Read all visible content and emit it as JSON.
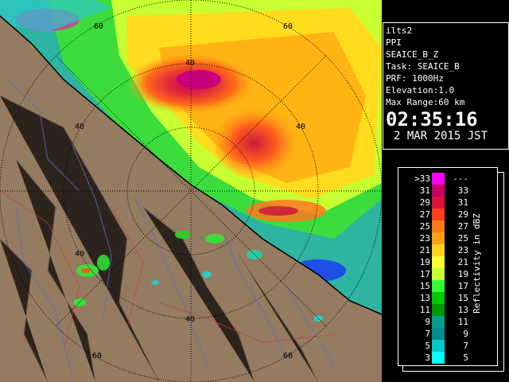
{
  "info": {
    "radar": "ilts2",
    "scan": "PPI",
    "product": "SEAICE_B_Z",
    "task": "Task: SEAICE_B",
    "prf": "PRF: 1000Hz",
    "elevation": "Elevation:1.0",
    "max_range": "Max Range:60 km",
    "time": "02:35:16",
    "date": "2 MAR 2015 JST"
  },
  "range_labels": [
    "40",
    "60",
    "40",
    "60",
    "40",
    "40",
    "60",
    "40",
    "60"
  ],
  "legend": {
    "title": "Reflectivity in dBZ",
    "rows": [
      {
        "lo": ">33",
        "hi": "---",
        "color": "#ff00ff"
      },
      {
        "lo": "31",
        "hi": "33",
        "color": "#c80064"
      },
      {
        "lo": "29",
        "hi": "31",
        "color": "#dc143c"
      },
      {
        "lo": "27",
        "hi": "29",
        "color": "#ff3c1e"
      },
      {
        "lo": "25",
        "hi": "27",
        "color": "#ff7814"
      },
      {
        "lo": "23",
        "hi": "25",
        "color": "#ffa014"
      },
      {
        "lo": "21",
        "hi": "23",
        "color": "#ffd21e"
      },
      {
        "lo": "19",
        "hi": "21",
        "color": "#ffff32"
      },
      {
        "lo": "17",
        "hi": "19",
        "color": "#c8ff32"
      },
      {
        "lo": "15",
        "hi": "17",
        "color": "#32ff32"
      },
      {
        "lo": "13",
        "hi": "15",
        "color": "#00c800"
      },
      {
        "lo": "11",
        "hi": "13",
        "color": "#009600"
      },
      {
        "lo": "9",
        "hi": "11",
        "color": "#00a08c"
      },
      {
        "lo": "7",
        "hi": "9",
        "color": "#008c8c"
      },
      {
        "lo": "5",
        "hi": "7",
        "color": "#00c8c8"
      },
      {
        "lo": "3",
        "hi": "5",
        "color": "#00ffff"
      }
    ]
  }
}
